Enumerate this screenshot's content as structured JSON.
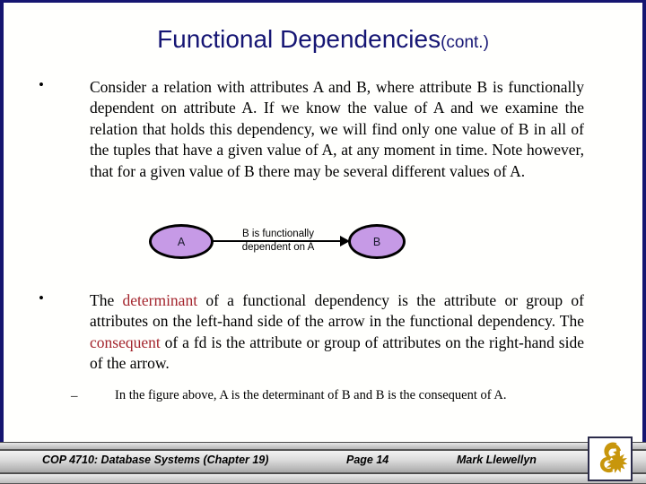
{
  "slide": {
    "title_main": "Functional Dependencies",
    "title_cont": "(cont.)",
    "title_color": "#161674",
    "border_color": "#151570",
    "background": "#fffffd"
  },
  "bullets": [
    {
      "marker": "•",
      "text": "Consider a relation with attributes A and B, where attribute B is functionally dependent on attribute A.  If we know the value of A and we examine the relation that holds this dependency, we will find only one value of B in all of the tuples that have a given value of A, at any moment in time.  Note however, that for a given value of B there may be several different values of A."
    },
    {
      "marker": "•",
      "segments": [
        {
          "text": "The ",
          "color": "#000000"
        },
        {
          "text": "determinant",
          "color": "#a3242c"
        },
        {
          "text": " of a functional dependency is the attribute or group of attributes on the left-hand side of the arrow in the functional dependency.   The ",
          "color": "#000000"
        },
        {
          "text": "consequent",
          "color": "#a3242c"
        },
        {
          "text": " of a fd is the attribute or group of attributes on the right-hand side of the arrow.",
          "color": "#000000"
        }
      ],
      "lead": "The ",
      "hl1": "determinant",
      "mid": " of a functional dependency is the attribute or group of attributes on the left-hand side of the arrow in the functional dependency.   The ",
      "hl2": "consequent",
      "tail": " of a fd is the attribute or group of attributes on the right-hand side of the arrow."
    },
    {
      "marker": "–",
      "text": "In the figure above, A is the determinant of B and B is the consequent of A."
    }
  ],
  "figure": {
    "node_a_label": "A",
    "node_b_label": "B",
    "arrow_label_line1": "B is functionally",
    "arrow_label_line2": "dependent on A",
    "node_fill": "#c69ae6",
    "node_stroke": "#000000",
    "arrow_color": "#000000"
  },
  "footer": {
    "course": "COP 4710: Database Systems  (Chapter 19)",
    "page": "Page 14",
    "author": "Mark Llewellyn",
    "logo_color": "#c8960c"
  }
}
